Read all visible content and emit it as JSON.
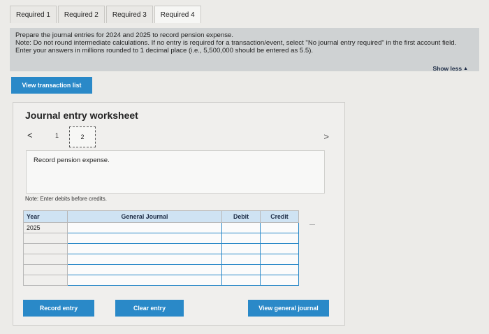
{
  "tabs": [
    {
      "label": "Required 1"
    },
    {
      "label": "Required 2"
    },
    {
      "label": "Required 3"
    },
    {
      "label": "Required 4"
    }
  ],
  "instructions": {
    "line1": "Prepare the journal entries for 2024 and 2025 to record pension expense.",
    "line2": "Note: Do not round intermediate calculations. If no entry is required for a transaction/event, select \"No journal entry required\" in the first account field. Enter your answers in millions rounded to 1 decimal place (i.e., 5,500,000 should be entered as 5.5)."
  },
  "show_less": {
    "label": "Show less",
    "icon": "triangle-up-icon"
  },
  "view_transaction_list": "View transaction list",
  "worksheet": {
    "title": "Journal entry worksheet",
    "pager": {
      "prev": "<",
      "pages": [
        "1",
        "2"
      ],
      "current": "2",
      "next": ">"
    },
    "entry_description": "Record pension expense.",
    "note": "Note: Enter debits before credits.",
    "columns": {
      "year": "Year",
      "account": "General Journal",
      "debit": "Debit",
      "credit": "Credit"
    },
    "rows": [
      {
        "year": "2025",
        "account": "",
        "debit": "",
        "credit": ""
      },
      {
        "year": "",
        "account": "",
        "debit": "",
        "credit": ""
      },
      {
        "year": "",
        "account": "",
        "debit": "",
        "credit": ""
      },
      {
        "year": "",
        "account": "",
        "debit": "",
        "credit": ""
      },
      {
        "year": "",
        "account": "",
        "debit": "",
        "credit": ""
      },
      {
        "year": "",
        "account": "",
        "debit": "",
        "credit": ""
      }
    ],
    "buttons": {
      "record": "Record entry",
      "clear": "Clear entry",
      "view_general": "View general journal"
    }
  },
  "colors": {
    "accent": "#2a89c8",
    "header_bg": "#cfe3f3",
    "instruction_bg": "#cfd2d3"
  }
}
